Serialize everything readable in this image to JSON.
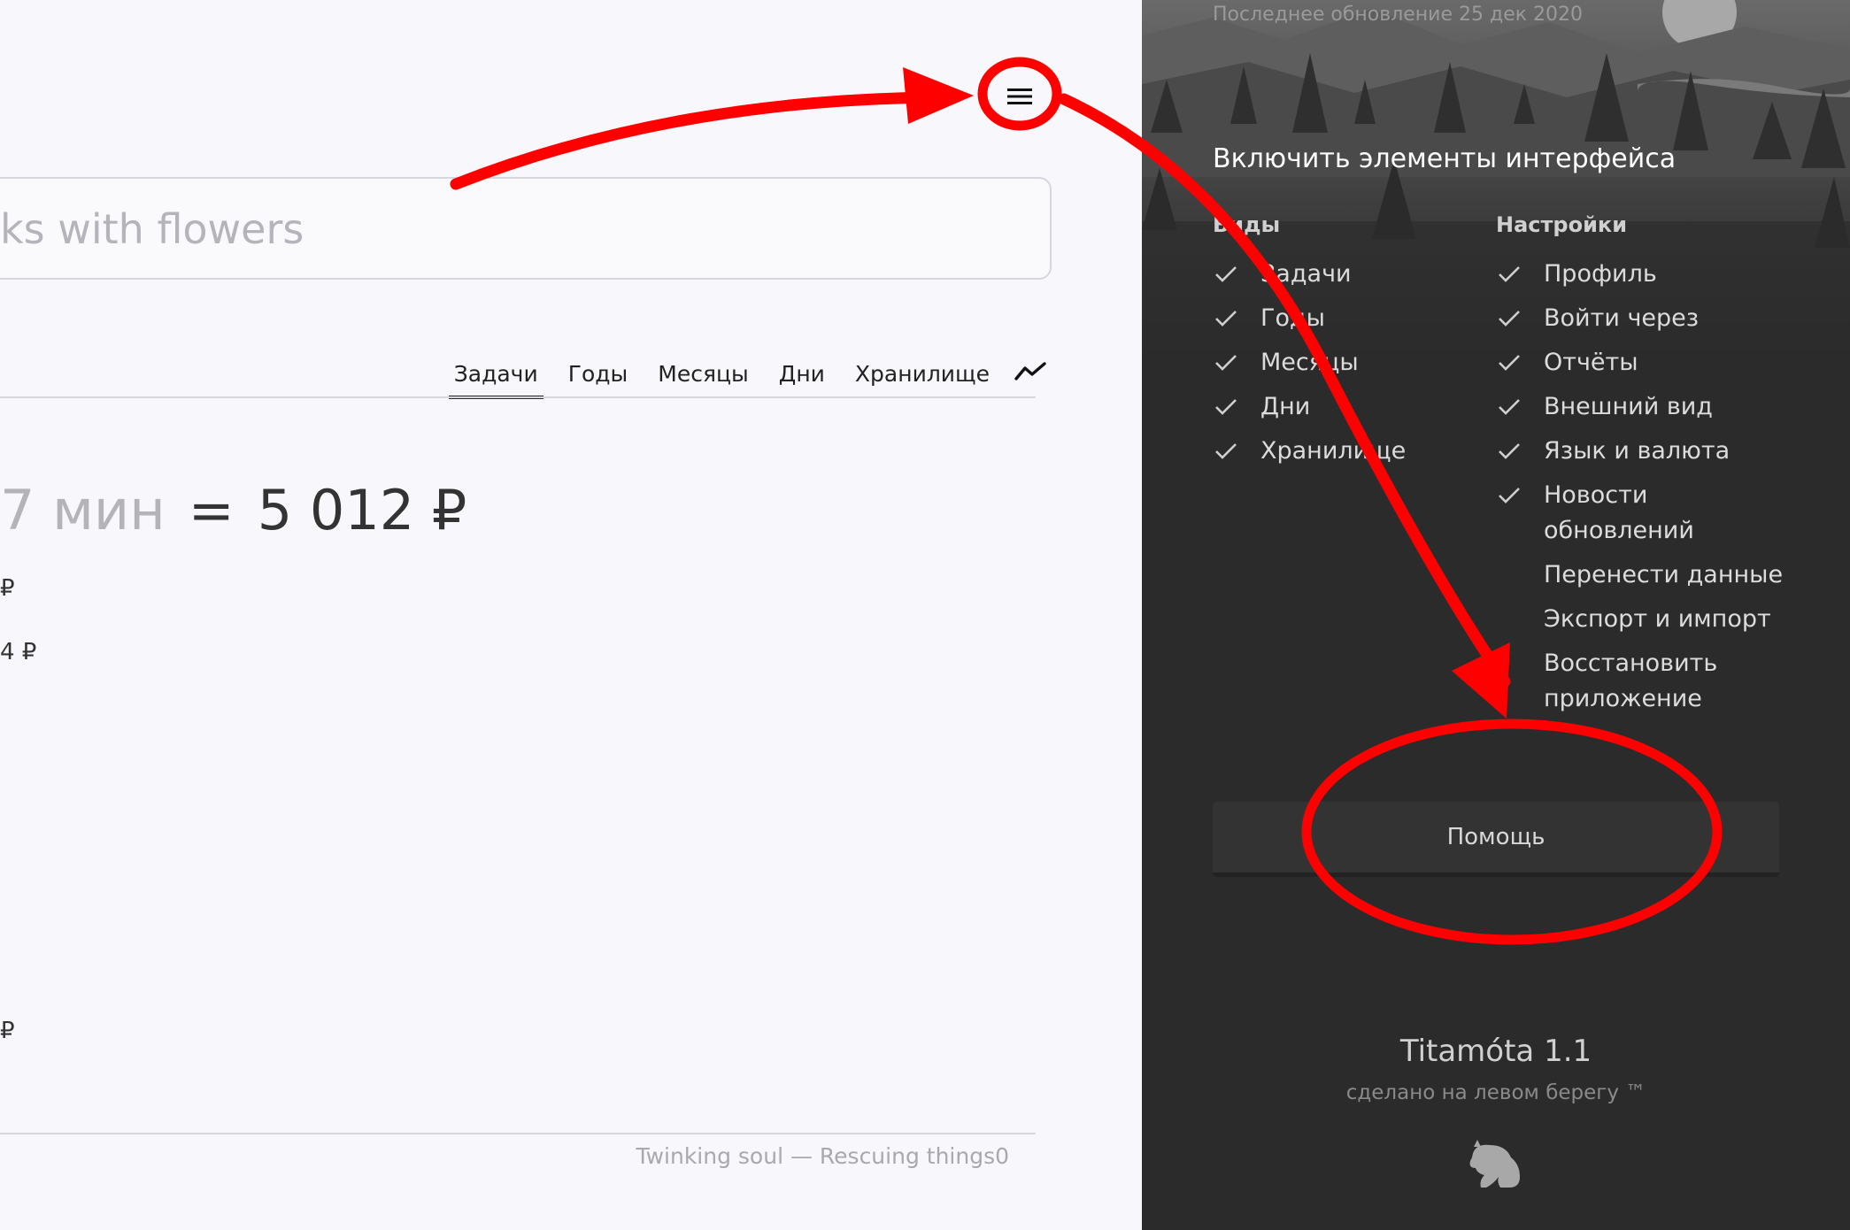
{
  "main": {
    "search_value": "ks with flowers",
    "tabs": [
      {
        "label": "Задачи"
      },
      {
        "label": "Годы"
      },
      {
        "label": "Месяцы"
      },
      {
        "label": "Дни"
      },
      {
        "label": "Хранилище"
      }
    ],
    "summary": {
      "duration": "7 мин",
      "equals": "=",
      "amount": "5 012 ₽"
    },
    "fragments": [
      "₽",
      "4 ₽",
      "₽"
    ],
    "footer_credit": "Twinking soul — Rescuing things0"
  },
  "panel": {
    "last_updated": "Последнее обновление 25 дек 2020",
    "title": "Включить элементы интерфейса",
    "views_heading": "Виды",
    "views": [
      "Задачи",
      "Годы",
      "Месяцы",
      "Дни",
      "Хранилище"
    ],
    "settings_heading": "Настройки",
    "settings_checked": [
      "Профиль",
      "Войти через",
      "Отчёты",
      "Внешний вид",
      "Язык и валюта",
      "Новости обновлений"
    ],
    "settings_actions": [
      "Перенести данные",
      "Экспорт и импорт",
      "Восстановить приложение"
    ],
    "help_label": "Помощь",
    "app_name": "Titamóta 1.1",
    "tagline": "сделано на левом берегу ™"
  },
  "icons": {
    "menu": "hamburger-menu-icon",
    "trend": "trend-line-icon",
    "check": "checkmark-icon",
    "logo": "sitting-cat-logo-icon"
  },
  "colors": {
    "annotation": "#ff0000",
    "panel_bg": "#2b2b2b",
    "main_bg": "#f8f8fc"
  }
}
